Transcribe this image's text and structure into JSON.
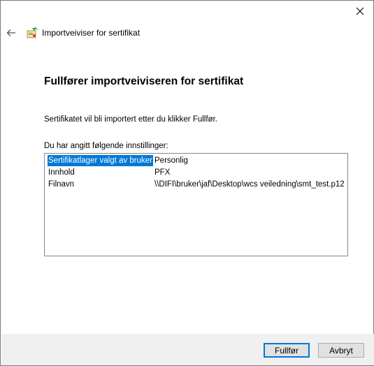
{
  "window": {
    "wizard_title": "Importveiviser for sertifikat",
    "close_icon": "close-icon",
    "back_icon": "back-arrow-icon",
    "app_icon": "certificate-wizard-icon"
  },
  "main": {
    "heading": "Fullfører importveiviseren for sertifikat",
    "description": "Sertifikatet vil bli importert etter du klikker Fullfør.",
    "settings_label": "Du har angitt følgende innstillinger:",
    "settings": [
      {
        "key": "Sertifikatlager valgt av bruker",
        "value": "Personlig",
        "selected": true
      },
      {
        "key": "Innhold",
        "value": "PFX",
        "selected": false
      },
      {
        "key": "Filnavn",
        "value": "\\\\DIFI\\bruker\\jaf\\Desktop\\wcs veiledning\\smt_test.p12",
        "selected": false
      }
    ]
  },
  "footer": {
    "finish_label": "Fullfør",
    "cancel_label": "Avbryt"
  },
  "colors": {
    "selection": "#0078d7",
    "footer_bg": "#f0f0f0",
    "button_bg": "#e1e1e1"
  }
}
